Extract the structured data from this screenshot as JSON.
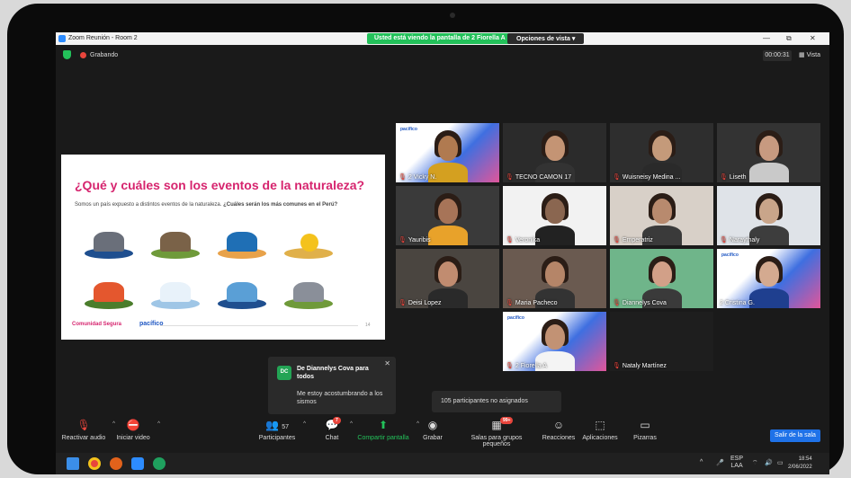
{
  "window": {
    "title": "Zoom Reunión - Room 2",
    "banner": "Usted está viendo la pantalla de 2 Fiorella A",
    "view_options": "Opciones de vista ▾",
    "minimize": "—",
    "restore": "⧉",
    "close": "✕"
  },
  "status": {
    "recording": "Grabando",
    "timer": "00:00:31",
    "view": "Vista"
  },
  "slide": {
    "title": "¿Qué y cuáles son los eventos de la naturaleza?",
    "subtitle_plain": "Somos un país expuesto a distintos eventos de la naturaleza. ",
    "subtitle_bold": "¿Cuáles serán los más comunes en el Perú?",
    "logo_left": "Comunidad Segura",
    "logo_right": "pacífico",
    "page_number": "14",
    "illustrations": [
      "storm-wind",
      "landslide",
      "tsunami-wave",
      "heat-sun",
      "wildfire",
      "flood-snow",
      "volcano-ice",
      "lightning-storm"
    ]
  },
  "participants": [
    {
      "name": "2 Vicky N.",
      "muted": true
    },
    {
      "name": "TECNO CAMON 17",
      "muted": true
    },
    {
      "name": "Wuisneisy Medina ...",
      "muted": true
    },
    {
      "name": "Liseth",
      "muted": true
    },
    {
      "name": "Yauribis",
      "muted": true
    },
    {
      "name": "Veronika",
      "muted": true
    },
    {
      "name": "Emperatriz",
      "muted": true
    },
    {
      "name": "Naraythaly",
      "muted": true
    },
    {
      "name": "Deisi Lopez",
      "muted": true
    },
    {
      "name": "Maria Pacheco",
      "muted": true
    },
    {
      "name": "Diannelys Cova",
      "muted": true
    },
    {
      "name": "2 Cristina G.",
      "muted": false
    },
    {
      "name": "2 Fiorella A",
      "muted": true
    },
    {
      "name": "Nataly Martínez",
      "muted": true
    }
  ],
  "tile_brand": "pacífico",
  "notification": {
    "initials": "DC",
    "from": "De Diannelys Cova para todos",
    "message": "Me estoy acostumbrando a los sismos",
    "close": "✕"
  },
  "unassigned": "105 participantes no asignados",
  "toolbar": {
    "unmute": "Reactivar audio",
    "start_video": "Iniciar video",
    "participants": "Participantes",
    "participants_count": "57",
    "chat": "Chat",
    "chat_badge": "7",
    "share": "Compartir pantalla",
    "record": "Grabar",
    "breakout": "Salas para grupos pequeños",
    "breakout_badge": "99+",
    "reactions": "Reacciones",
    "apps": "Aplicaciones",
    "whiteboards": "Pizarras",
    "leave_room": "Salir de la sala"
  },
  "taskbar": {
    "lang_top": "ESP",
    "lang_bottom": "LAA",
    "time": "18:54",
    "date": "2/06/2022",
    "chevron": "^"
  },
  "colors": {
    "zoom_blue": "#2d8cff",
    "share_green": "#23c15a",
    "slide_title_pink": "#d6246e",
    "active_speaker": "#c7e85a",
    "leave_blue": "#1f72e8"
  }
}
